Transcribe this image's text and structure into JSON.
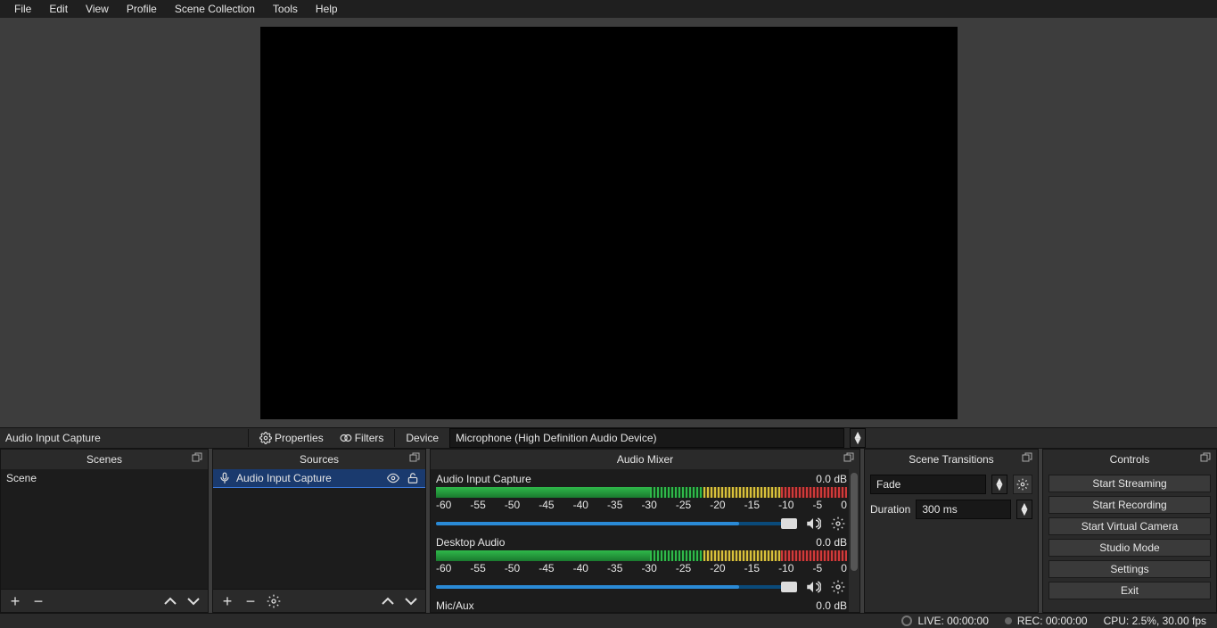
{
  "menu": {
    "items": [
      "File",
      "Edit",
      "View",
      "Profile",
      "Scene Collection",
      "Tools",
      "Help"
    ]
  },
  "context": {
    "source_label": "Audio Input Capture",
    "properties": "Properties",
    "filters": "Filters",
    "device_label": "Device",
    "device_value": "Microphone (High Definition Audio Device)"
  },
  "docks": {
    "scenes": {
      "title": "Scenes",
      "items": [
        "Scene"
      ]
    },
    "sources": {
      "title": "Sources",
      "items": [
        {
          "name": "Audio Input Capture",
          "icon": "mic",
          "visible": true,
          "locked": false
        }
      ]
    },
    "mixer": {
      "title": "Audio Mixer",
      "ticks": [
        "-60",
        "-55",
        "-50",
        "-45",
        "-40",
        "-35",
        "-30",
        "-25",
        "-20",
        "-15",
        "-10",
        "-5",
        "0"
      ],
      "channels": [
        {
          "name": "Audio Input Capture",
          "db": "0.0 dB"
        },
        {
          "name": "Desktop Audio",
          "db": "0.0 dB"
        },
        {
          "name": "Mic/Aux",
          "db": "0.0 dB"
        }
      ]
    },
    "transitions": {
      "title": "Scene Transitions",
      "selected": "Fade",
      "duration_label": "Duration",
      "duration_value": "300 ms"
    },
    "controls": {
      "title": "Controls",
      "buttons": [
        "Start Streaming",
        "Start Recording",
        "Start Virtual Camera",
        "Studio Mode",
        "Settings",
        "Exit"
      ]
    }
  },
  "status": {
    "live": "LIVE: 00:00:00",
    "rec": "REC: 00:00:00",
    "cpu": "CPU: 2.5%, 30.00 fps"
  }
}
